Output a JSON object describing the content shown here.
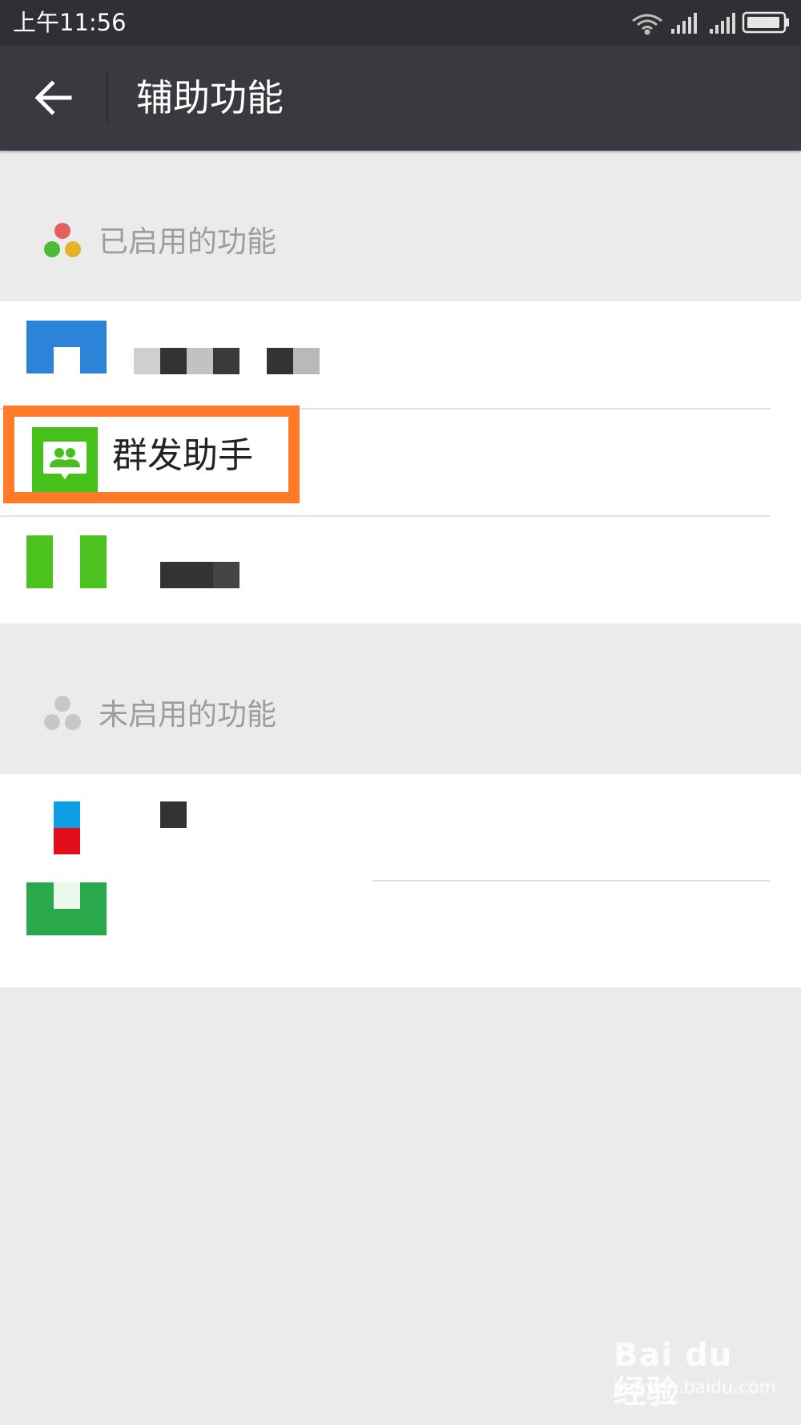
{
  "status_bar": {
    "time": "上午11:56",
    "icons": [
      "wifi-icon",
      "signal-icon",
      "signal-icon",
      "battery-icon"
    ]
  },
  "app_bar": {
    "back_icon": "arrow-left-icon",
    "title": "辅助功能"
  },
  "enabled_section": {
    "title": "已启用的功能",
    "icon": "three-dots-colored-icon",
    "dot_colors": [
      "#e2615f",
      "#4cb938",
      "#e3b42b"
    ],
    "items": [
      {
        "label": "",
        "icon": "redacted-blue-icon",
        "redacted": true
      },
      {
        "label": "群发助手",
        "icon": "mass-message-assistant-icon",
        "icon_color": "#46c11b",
        "highlighted": true
      },
      {
        "label": "",
        "icon": "redacted-green-icon",
        "redacted": true
      }
    ]
  },
  "disabled_section": {
    "title": "未启用的功能",
    "icon": "three-dots-gray-icon",
    "items": [
      {
        "label": "",
        "icon": "redacted-blue-red-icon",
        "redacted": true
      },
      {
        "label": "",
        "icon": "redacted-dark-green-icon",
        "redacted": true
      }
    ]
  },
  "watermark": {
    "brand": "Bai du 经验",
    "url": "jingyan.baidu.com"
  },
  "colors": {
    "status_bar": "#2f3033",
    "app_bar": "#393a3f",
    "background": "#ebebeb",
    "highlight": "#ff7b29"
  }
}
